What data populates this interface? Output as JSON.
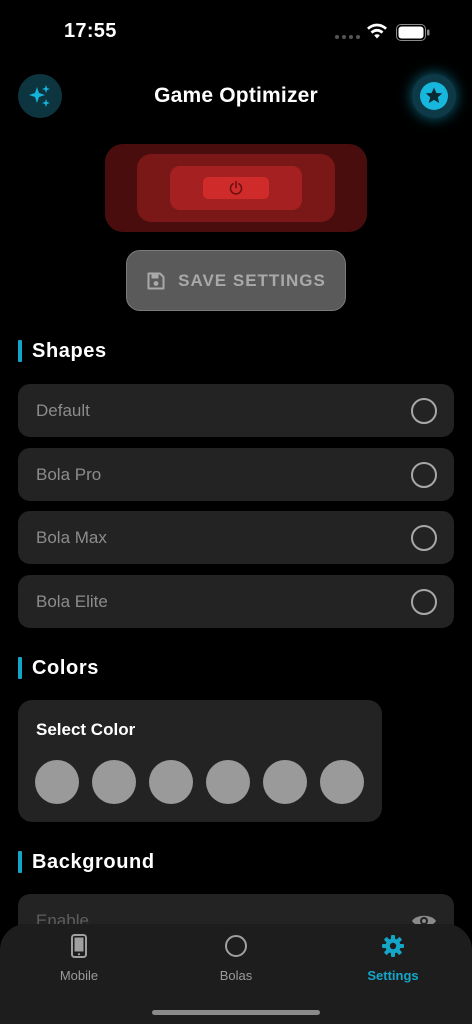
{
  "status_bar": {
    "time": "17:55"
  },
  "header": {
    "title": "Game Optimizer",
    "left_icon": "sparkles-icon",
    "right_icon": "star-icon"
  },
  "power": {
    "icon": "power-icon"
  },
  "save_button": {
    "label": "SAVE SETTINGS",
    "icon": "save-icon"
  },
  "sections": {
    "shapes": {
      "title": "Shapes",
      "options": [
        {
          "label": "Default",
          "selected": false
        },
        {
          "label": "Bola Pro",
          "selected": false
        },
        {
          "label": "Bola Max",
          "selected": false
        },
        {
          "label": "Bola Elite",
          "selected": false
        }
      ]
    },
    "colors": {
      "title": "Colors",
      "card_title": "Select Color",
      "swatches": [
        "#9a9a9a",
        "#9a9a9a",
        "#9a9a9a",
        "#9a9a9a",
        "#9a9a9a",
        "#9a9a9a"
      ]
    },
    "background": {
      "title": "Background",
      "enable_label": "Enable",
      "enable_icon": "eye-icon"
    }
  },
  "tab_bar": {
    "tabs": [
      {
        "label": "Mobile",
        "icon": "phone-icon",
        "active": false
      },
      {
        "label": "Bolas",
        "icon": "circle-icon",
        "active": false
      },
      {
        "label": "Settings",
        "icon": "gear-icon",
        "active": true
      }
    ]
  },
  "colors": {
    "accent": "#14a6c9",
    "power_red": "#cf2b2b",
    "row_bg": "#232323"
  }
}
